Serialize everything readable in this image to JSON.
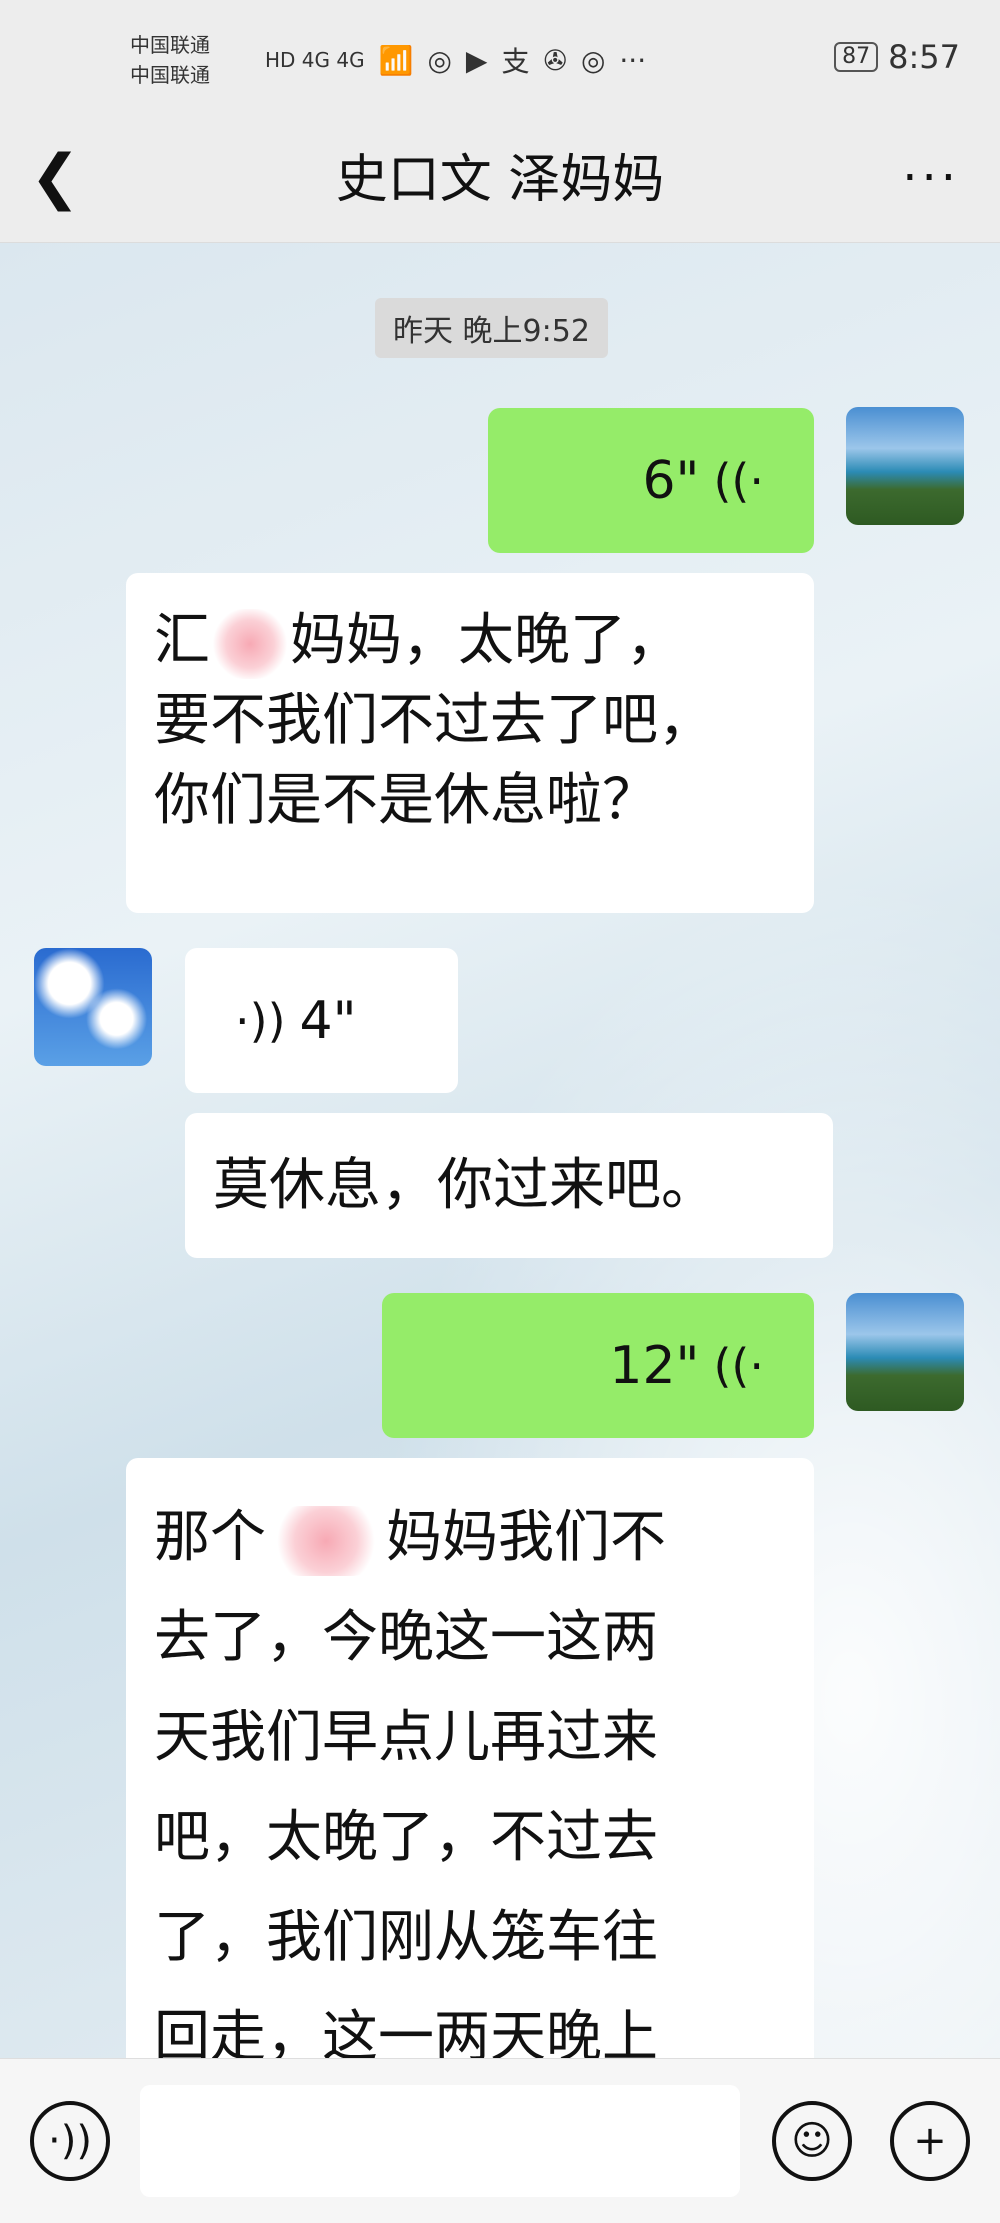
{
  "status_bar": {
    "carrier_1": "中国联通",
    "carrier_2": "中国联通",
    "network": "HD 4G 4G",
    "battery": "87",
    "time": "8:57"
  },
  "header": {
    "back_icon": "chevron-left-icon",
    "title": "史口文  泽妈妈",
    "more_icon": "more-dots-icon"
  },
  "chat": {
    "time_label": "昨天 晚上9:52",
    "messages": [
      {
        "side": "right",
        "type": "voice",
        "duration": "6\""
      },
      {
        "side": "left",
        "type": "text",
        "line1_rest": "妈妈，太晚了，",
        "line2": "要不我们不过去了吧，",
        "line3": "你们是不是休息啦？"
      },
      {
        "side": "left",
        "type": "voice",
        "duration": "4\""
      },
      {
        "side": "left",
        "type": "text",
        "text": "莫休息，你过来吧。"
      },
      {
        "side": "right",
        "type": "voice",
        "duration": "12\""
      },
      {
        "side": "left",
        "type": "text",
        "line1_a": "那个",
        "line1_b": "妈妈我们不",
        "line2": "去了，今晚这一这两",
        "line3": "天我们早点儿再过来",
        "line4": "吧，太晚了，不过去",
        "line5": "了，我们刚从笼车往",
        "line6": "回走，这一两天晚上"
      }
    ]
  },
  "colors": {
    "sent_bubble": "#95ec69",
    "received_bubble": "#ffffff",
    "header_bg": "#ededed"
  },
  "input_bar": {
    "voice_icon": "voice-toggle-icon",
    "emoji_icon": "emoji-icon",
    "add_icon": "plus-icon"
  }
}
